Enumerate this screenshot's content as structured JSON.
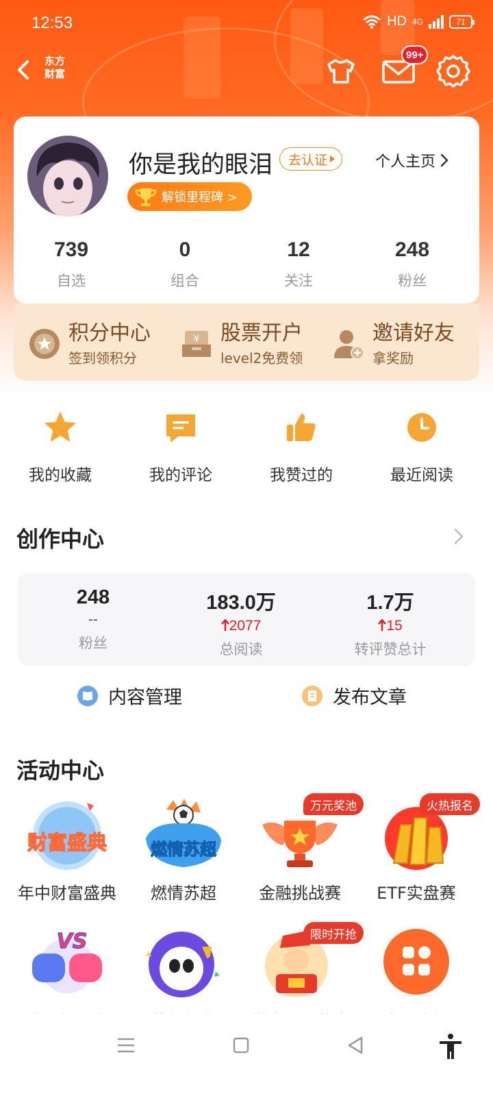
{
  "status_bar": {
    "time": "12:53",
    "network": "HD",
    "cell": "4G",
    "battery": "71"
  },
  "header": {
    "brand_line1": "东方",
    "brand_line2": "财富",
    "mail_badge": "99+"
  },
  "profile": {
    "username": "你是我的眼泪",
    "verify_label": "去认证",
    "homepage_label": "个人主页",
    "milestone_label": "解锁里程碑 >",
    "stats": [
      {
        "value": "739",
        "label": "自选"
      },
      {
        "value": "0",
        "label": "组合"
      },
      {
        "value": "12",
        "label": "关注"
      },
      {
        "value": "248",
        "label": "粉丝"
      }
    ]
  },
  "promos": [
    {
      "title": "积分中心",
      "subtitle": "签到领积分",
      "icon": "points-medal-icon"
    },
    {
      "title": "股票开户",
      "subtitle": "level2免费领",
      "icon": "account-box-icon"
    },
    {
      "title": "邀请好友",
      "subtitle": "拿奖励",
      "icon": "invite-user-icon"
    }
  ],
  "quick_actions": [
    {
      "label": "我的收藏",
      "icon": "star-icon"
    },
    {
      "label": "我的评论",
      "icon": "comment-icon"
    },
    {
      "label": "我赞过的",
      "icon": "thumbs-up-icon"
    },
    {
      "label": "最近阅读",
      "icon": "clock-icon"
    }
  ],
  "creator": {
    "title": "创作中心",
    "stats": [
      {
        "value": "248",
        "delta": "--",
        "label": "粉丝"
      },
      {
        "value": "183.0万",
        "delta": "2077",
        "label": "总阅读"
      },
      {
        "value": "1.7万",
        "delta": "15",
        "label": "转评赞总计"
      }
    ],
    "manage_label": "内容管理",
    "publish_label": "发布文章"
  },
  "activity": {
    "title": "活动中心",
    "items": [
      {
        "label": "年中财富盛典",
        "art_text": "财富盛典",
        "badge": ""
      },
      {
        "label": "燃情苏超",
        "art_text": "燃情苏超",
        "badge": ""
      },
      {
        "label": "金融挑战赛",
        "art_text": "",
        "badge": "万元奖池"
      },
      {
        "label": "ETF实盘赛",
        "art_text": "",
        "badge": "火热报名"
      },
      {
        "label": "选股擂台赛",
        "art_text": "VS",
        "badge": ""
      },
      {
        "label": "苏超集卡",
        "art_text": "",
        "badge": ""
      },
      {
        "label": "攒金豆兑黄金",
        "art_text": "",
        "badge": "限时开抢"
      },
      {
        "label": "查看全部",
        "art_text": "",
        "badge": ""
      }
    ]
  },
  "colors": {
    "brand_orange": "#ff5a14",
    "accent_red": "#e02020",
    "promo_bg": "#fbe6cf",
    "icon_orange": "#f7a634"
  }
}
